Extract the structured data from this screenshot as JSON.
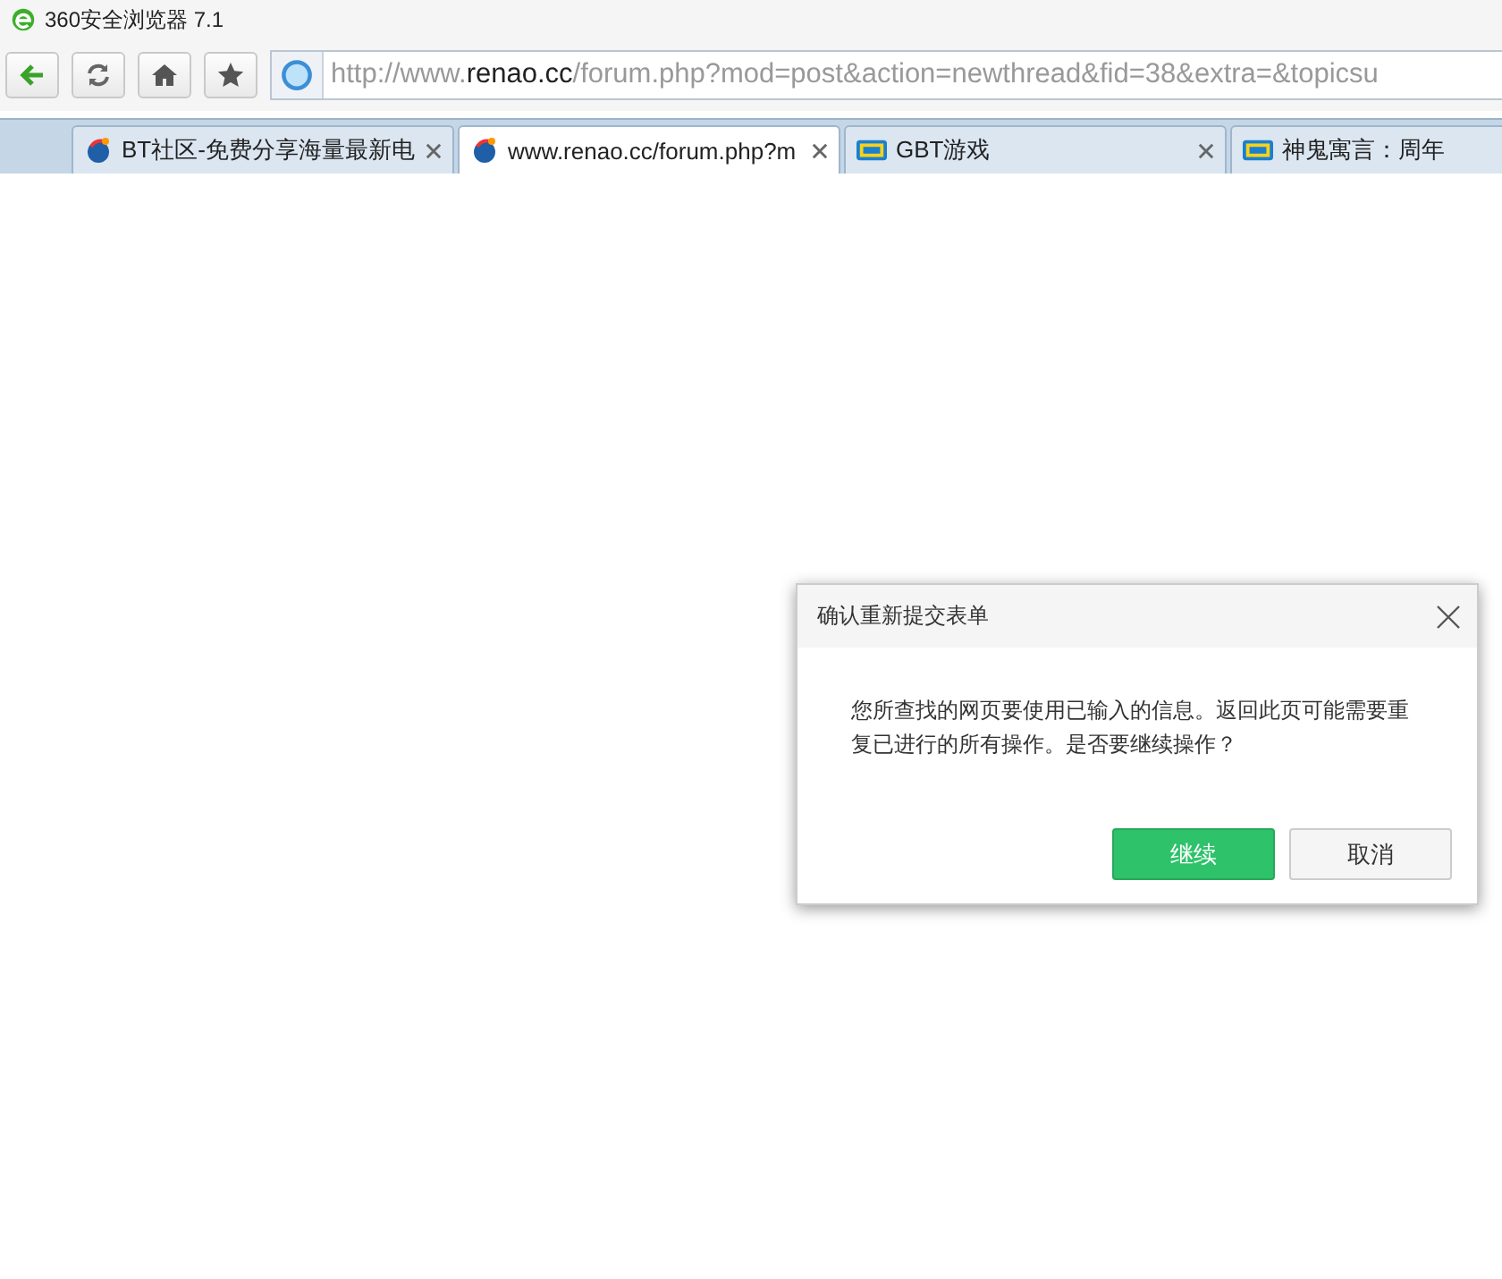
{
  "window": {
    "title": "360安全浏览器 7.1"
  },
  "address_bar": {
    "url": "http://www.**renao.cc**/forum.php?mod=post&action=newthread&fid=38&extra=&topicsu"
  },
  "tabs": [
    {
      "label": "BT社区-免费分享海量最新电",
      "kind": "globe",
      "selected": false
    },
    {
      "label": "www.renao.cc/forum.php?m",
      "kind": "globe",
      "selected": true
    },
    {
      "label": "GBT游戏",
      "kind": "bt",
      "selected": false
    },
    {
      "label": "神鬼寓言：周年",
      "kind": "bt",
      "selected": false
    }
  ],
  "dialog": {
    "title": "确认重新提交表单",
    "message": "您所查找的网页要使用已输入的信息。返回此页可能需要重复已进行的所有操作。是否要继续操作？",
    "buttons": [
      {
        "label": "继续",
        "kind": "primary"
      },
      {
        "label": "取消",
        "kind": "secondary"
      }
    ]
  }
}
